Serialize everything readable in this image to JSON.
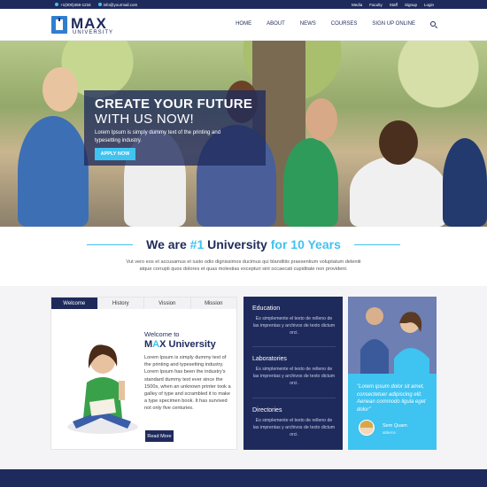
{
  "topbar": {
    "phone": "+1(000)456-1234",
    "email": "info@yourmail.com",
    "links": [
      "Media",
      "Faculty",
      "Staff",
      "Signup",
      "Login"
    ]
  },
  "logo": {
    "name": "MAX",
    "sub": "UNIVERSITY"
  },
  "nav": [
    "HOME",
    "ABOUT",
    "NEWS",
    "COURSES",
    "SIGN UP ONLINE"
  ],
  "hero": {
    "title": "CREATE YOUR FUTURE",
    "subtitle": "WITH US NOW!",
    "desc": "Lorem Ipsum is simply dummy text of the printing and typesetting industry.",
    "button": "APPLY NOW"
  },
  "intro": {
    "pre": "We are ",
    "accent1": "#1",
    "mid": " University ",
    "accent2": "for 10 Years",
    "desc": "Vut vero eos et accusamus et iusto odio dignissimos ducimus qui blanditiis praesentium voluptatum deleniti atque corrupti quos dolores et quas molestias excepturi sint occaecati cupiditate non provident."
  },
  "tabs": [
    "Welcome",
    "History",
    "Vission",
    "Mission"
  ],
  "welcome": {
    "pre": "Welcome to",
    "title_m": "M",
    "title_a": "A",
    "title_rest": "X University",
    "text": "Lorem Ipsum is simply dummy text of the printing and typesetting industry. Lorem Ipsum has been the industry's standard dummy text ever since the 1500s, when an unknown printer took a galley of type and scrambled it to make a type specimen book. It has survived not only five centuries.",
    "button": "Read More"
  },
  "middle": [
    {
      "title": "Education",
      "text": "Es simplemente el texto de relleno de las imprentas y archivos de texto dictum orci."
    },
    {
      "title": "Laboratories",
      "text": "Es simplemente el texto de relleno de las imprentas y archivos de texto dictum orci."
    },
    {
      "title": "Directories",
      "text": "Es simplemente el texto de relleno de las imprentas y archivos de texto dictum orci."
    }
  ],
  "quote": {
    "text": "\"Lorem ipsum dolor sit amet, consectetuer adipiscing elit. Aenean commodo ligula eget dolor\"",
    "name": "Sem Quam",
    "role": "alderns"
  },
  "colors": {
    "navy": "#1f2a5c",
    "accent": "#3fc3f0"
  }
}
